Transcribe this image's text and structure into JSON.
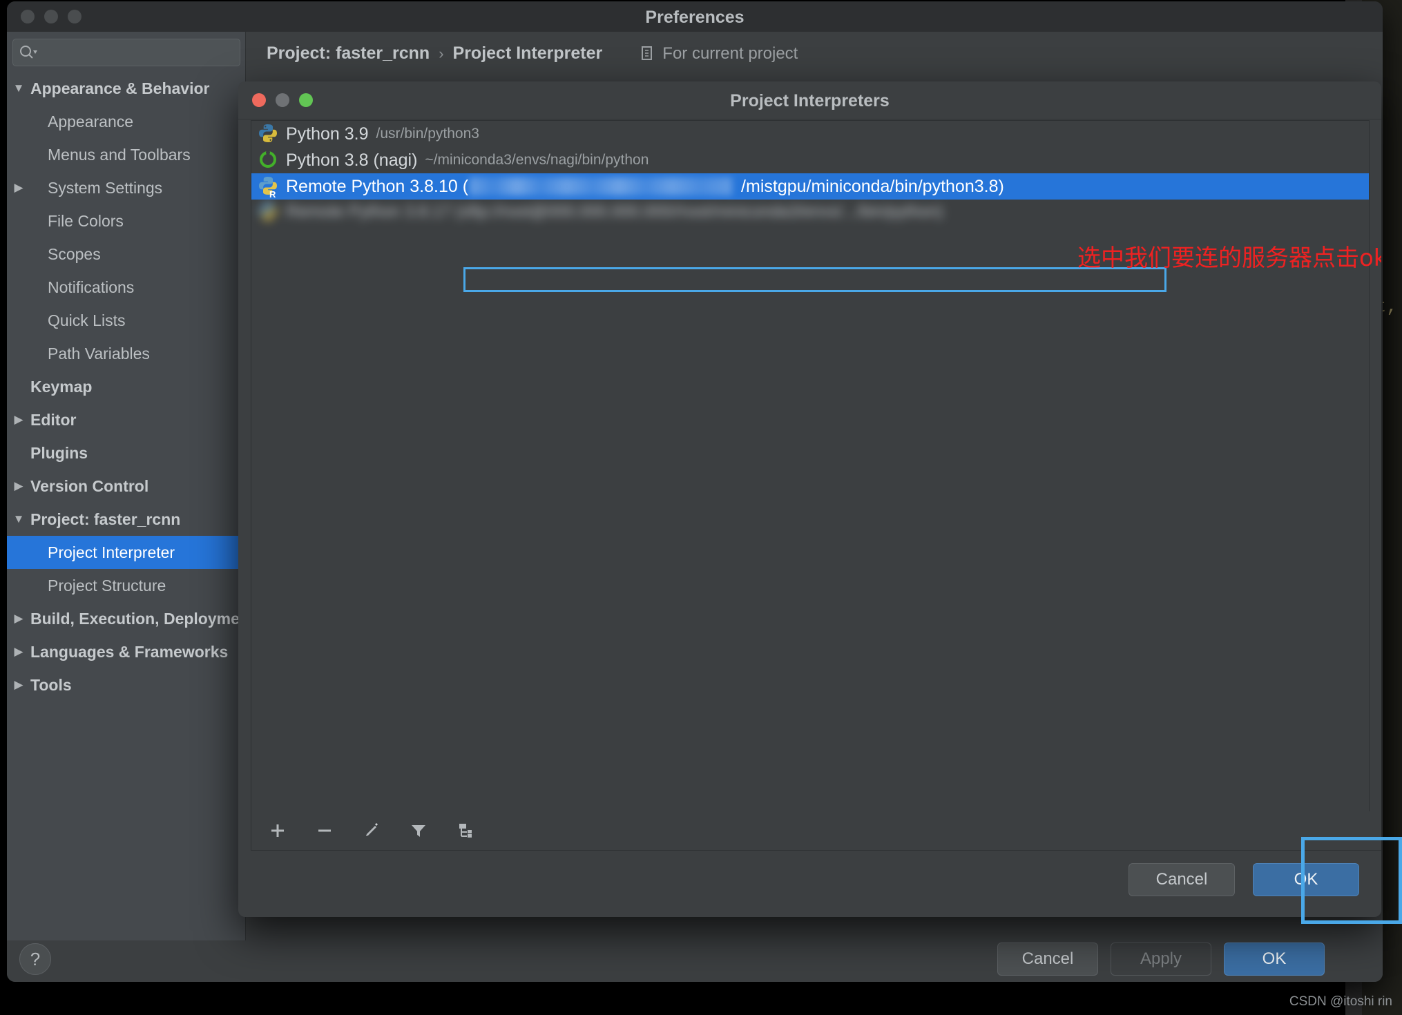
{
  "preferences": {
    "title": "Preferences",
    "search": {
      "value": "",
      "placeholder": ""
    },
    "breadcrumb": {
      "project": "Project: faster_rcnn",
      "separator": "›",
      "page": "Project Interpreter",
      "scope": "For current project"
    },
    "sidebar": [
      {
        "label": "Appearance & Behavior",
        "twisty": "▼",
        "group": true,
        "indent": 1,
        "selected": false
      },
      {
        "label": "Appearance",
        "twisty": "",
        "group": false,
        "indent": 2,
        "selected": false
      },
      {
        "label": "Menus and Toolbars",
        "twisty": "",
        "group": false,
        "indent": 2,
        "selected": false
      },
      {
        "label": "System Settings",
        "twisty": "▶",
        "group": false,
        "indent": 2,
        "selected": false
      },
      {
        "label": "File Colors",
        "twisty": "",
        "group": false,
        "indent": 2,
        "selected": false
      },
      {
        "label": "Scopes",
        "twisty": "",
        "group": false,
        "indent": 2,
        "selected": false
      },
      {
        "label": "Notifications",
        "twisty": "",
        "group": false,
        "indent": 2,
        "selected": false
      },
      {
        "label": "Quick Lists",
        "twisty": "",
        "group": false,
        "indent": 2,
        "selected": false
      },
      {
        "label": "Path Variables",
        "twisty": "",
        "group": false,
        "indent": 2,
        "selected": false
      },
      {
        "label": "Keymap",
        "twisty": "",
        "group": true,
        "indent": 1,
        "selected": false
      },
      {
        "label": "Editor",
        "twisty": "▶",
        "group": true,
        "indent": 1,
        "selected": false
      },
      {
        "label": "Plugins",
        "twisty": "",
        "group": true,
        "indent": 1,
        "selected": false
      },
      {
        "label": "Version Control",
        "twisty": "▶",
        "group": true,
        "indent": 1,
        "selected": false
      },
      {
        "label": "Project: faster_rcnn",
        "twisty": "▼",
        "group": true,
        "indent": 1,
        "selected": false
      },
      {
        "label": "Project Interpreter",
        "twisty": "",
        "group": false,
        "indent": 2,
        "selected": true
      },
      {
        "label": "Project Structure",
        "twisty": "",
        "group": false,
        "indent": 2,
        "selected": false
      },
      {
        "label": "Build, Execution, Deployment",
        "twisty": "▶",
        "group": true,
        "indent": 1,
        "selected": false
      },
      {
        "label": "Languages & Frameworks",
        "twisty": "▶",
        "group": true,
        "indent": 1,
        "selected": false
      },
      {
        "label": "Tools",
        "twisty": "▶",
        "group": true,
        "indent": 1,
        "selected": false
      }
    ],
    "buttons": {
      "help": "?",
      "cancel": "Cancel",
      "apply": "Apply",
      "ok": "OK"
    }
  },
  "dialog": {
    "title": "Project Interpreters",
    "interpreters": [
      {
        "name": "Python 3.9",
        "path": "/usr/bin/python3",
        "icon": "python-icon",
        "selected": false,
        "blurred": false
      },
      {
        "name": "Python 3.8 (nagi)",
        "path": "~/miniconda3/envs/nagi/bin/python",
        "icon": "anaconda-icon",
        "selected": false,
        "blurred": false
      },
      {
        "name": "Remote Python 3.8.10 (",
        "path_tail": "/mistgpu/miniconda/bin/python3.8)",
        "icon": "remote-python-icon",
        "selected": true,
        "blurred": false,
        "host_censored": true
      },
      {
        "name": "Remote Python 3.8.17 (sftp://root@000.000.000.000//root/miniconda3/envs/.../bin/python)",
        "icon": "remote-python-icon",
        "selected": false,
        "blurred": true
      }
    ],
    "toolbar": [
      {
        "name": "add-interpreter-icon",
        "glyph": "+"
      },
      {
        "name": "remove-interpreter-icon",
        "glyph": "−"
      },
      {
        "name": "edit-interpreter-icon",
        "glyph": "pencil"
      },
      {
        "name": "filter-icon",
        "glyph": "funnel"
      },
      {
        "name": "show-paths-icon",
        "glyph": "tree"
      }
    ],
    "buttons": {
      "cancel": "Cancel",
      "ok": "OK"
    }
  },
  "annotations": {
    "note": "选中我们要连的服务器点击ok",
    "note_color": "#ee2222",
    "box_color": "#4aa8e8"
  },
  "background": {
    "code_fragment": "ct,"
  },
  "watermark": "CSDN @itoshi rin",
  "colors": {
    "selection_blue": "#2675d9",
    "primary_button": "#3b6ea3",
    "annotation_red": "#ee2222",
    "annotation_blue": "#4aa8e8",
    "window_bg": "#3c3f41",
    "sidebar_bg": "#45494d"
  }
}
